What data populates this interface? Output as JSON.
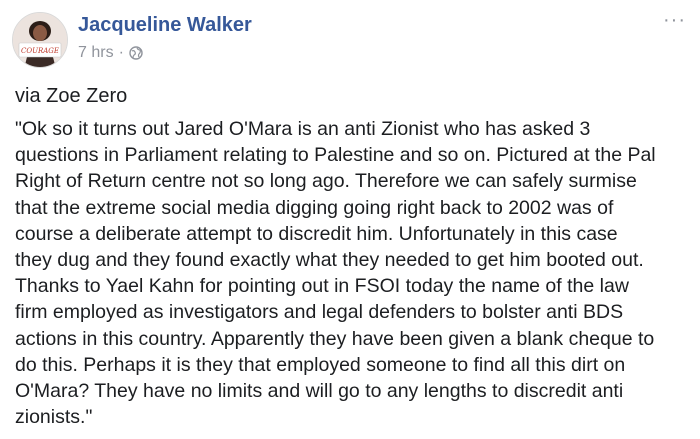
{
  "post": {
    "author": "Jacqueline Walker",
    "timestamp": "7 hrs",
    "separator": "·",
    "audience_icon": "globe-icon",
    "more_icon": "more-options-icon",
    "more_symbol": "···",
    "avatar_sign_text": "COURAGE",
    "via": "via Zoe Zero",
    "body_lines": [
      "\"Ok so it turns out Jared O'Mara is an anti Zionist who has asked 3",
      "questions in Parliament relating to Palestine and so on. Pictured at the Pal",
      "Right of Return centre not so long ago. Therefore we can safely surmise",
      "that the extreme social media digging going right back to 2002 was of",
      "course a deliberate attempt to discredit him. Unfortunately in this case",
      "they dug and they found exactly what they needed to get him booted out.",
      "Thanks to Yael Kahn for pointing out in FSOI today the name of the law",
      "firm employed as investigators and legal defenders to bolster anti BDS",
      "actions in this country. Apparently they have been given a blank cheque to",
      "do this. Perhaps it is they that employed someone to find all this dirt on",
      "O'Mara? They have no limits and will go to any lengths to discredit anti",
      "zionists.\""
    ]
  },
  "colors": {
    "author_link": "#365899",
    "meta_text": "#90949c",
    "body_text": "#1c1e21"
  }
}
